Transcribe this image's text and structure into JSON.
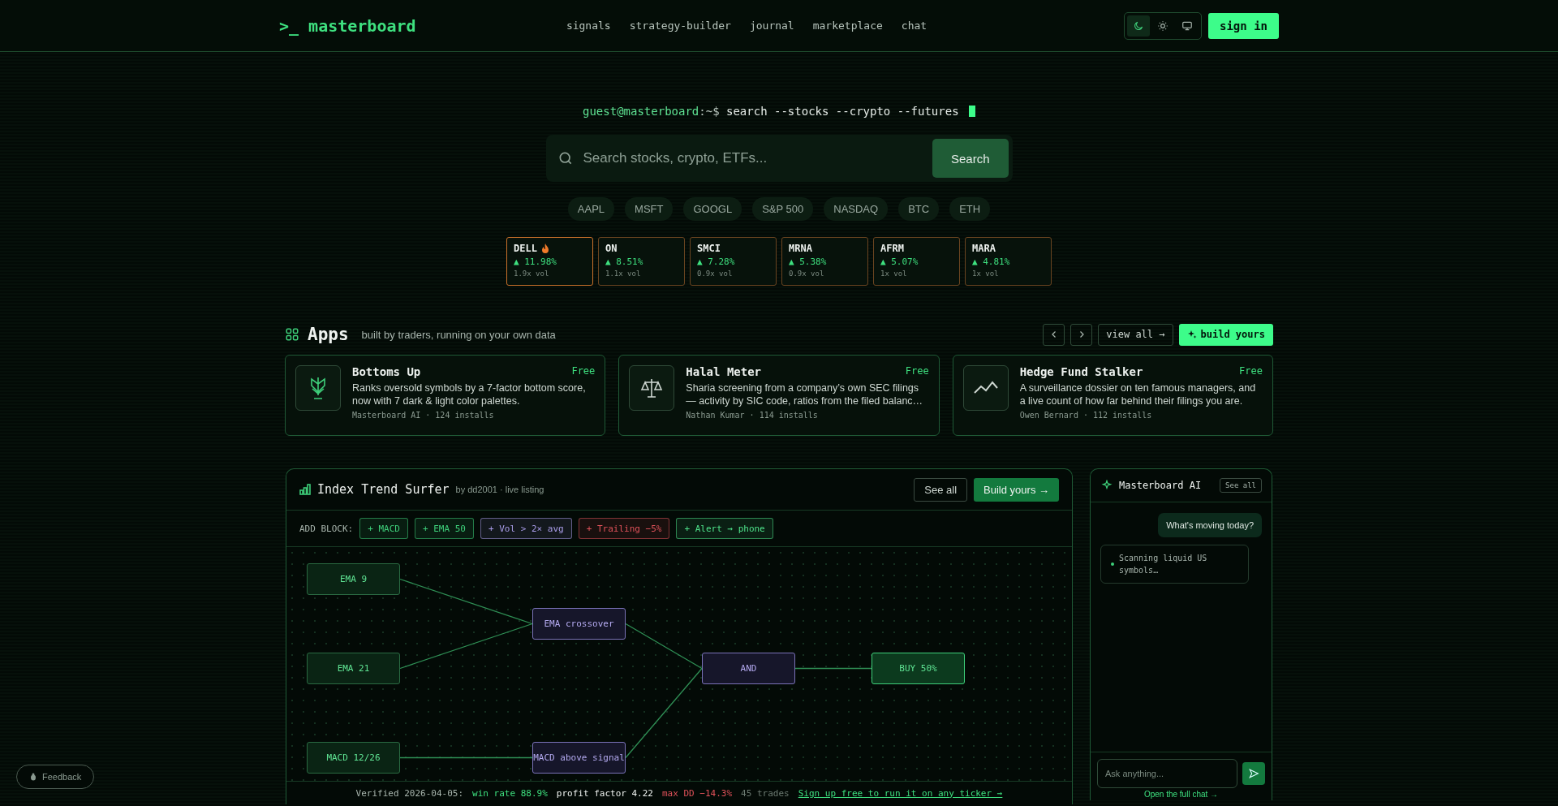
{
  "header": {
    "logo": ">_ masterboard",
    "nav": [
      "signals",
      "strategy-builder",
      "journal",
      "marketplace",
      "chat"
    ],
    "theme_options": [
      {
        "kind": "dark",
        "selected": true
      },
      {
        "kind": "light",
        "selected": false
      },
      {
        "kind": "system",
        "selected": false
      }
    ],
    "sign_in": "sign in"
  },
  "hero": {
    "prompt_user": "guest@masterboard",
    "prompt_path": ":~$",
    "command": "search --stocks --crypto --futures",
    "search": {
      "placeholder": "Search stocks, crypto, ETFs...",
      "button": "Search"
    },
    "chips": [
      "AAPL",
      "MSFT",
      "GOOGL",
      "S&P 500",
      "NASDAQ",
      "BTC",
      "ETH"
    ],
    "movers": [
      {
        "symbol": "DELL",
        "hot": true,
        "change": "▲ 11.98%",
        "volume": "1.9x vol"
      },
      {
        "symbol": "ON",
        "hot": false,
        "change": "▲ 8.51%",
        "volume": "1.1x vol"
      },
      {
        "symbol": "SMCI",
        "hot": false,
        "change": "▲ 7.28%",
        "volume": "0.9x vol"
      },
      {
        "symbol": "MRNA",
        "hot": false,
        "change": "▲ 5.38%",
        "volume": "0.9x vol"
      },
      {
        "symbol": "AFRM",
        "hot": false,
        "change": "▲ 5.07%",
        "volume": "1x vol"
      },
      {
        "symbol": "MARA",
        "hot": false,
        "change": "▲ 4.81%",
        "volume": "1x vol"
      }
    ]
  },
  "apps": {
    "title": "Apps",
    "subtitle": "built by traders, running on your own data",
    "view_all": "view all →",
    "build": "build yours",
    "items": [
      {
        "kind": "plant",
        "name": "Bottoms Up",
        "price": "Free",
        "description": "Ranks oversold symbols by a 7-factor bottom score, now with 7 dark & light color palettes.",
        "meta": "Masterboard AI · 124 installs"
      },
      {
        "kind": "scale",
        "name": "Halal Meter",
        "price": "Free",
        "description": "Sharia screening from a company’s own SEC filings — activity by SIC code, ratios from the filed balanc…",
        "meta": "Nathan Kumar · 114 installs"
      },
      {
        "kind": "chart",
        "name": "Hedge Fund Stalker",
        "price": "Free",
        "description": "A surveillance dossier on ten famous managers, and a live count of how far behind their filings you are.",
        "meta": "Owen Bernard · 112 installs"
      }
    ]
  },
  "builder": {
    "title": "Index Trend Surfer",
    "byline": "by dd2001 · live listing",
    "see_all": "See all",
    "build_yours": "Build yours →",
    "add_block_label": "ADD BLOCK:",
    "blocks": [
      {
        "label": "+ MACD",
        "color": "#3ecf7a"
      },
      {
        "label": "+ EMA 50",
        "color": "#3ecf7a"
      },
      {
        "label": "+ Vol > 2× avg",
        "color": "#a99ce8"
      },
      {
        "label": "+ Trailing −5%",
        "color": "#e0525a"
      },
      {
        "label": "+ Alert → phone",
        "color": "#4ee28a"
      }
    ],
    "nodes": [
      {
        "label": "EMA 9",
        "kind": "indicator"
      },
      {
        "label": "EMA 21",
        "kind": "indicator"
      },
      {
        "label": "MACD 12/26",
        "kind": "indicator"
      },
      {
        "label": "EMA crossover",
        "kind": "condition"
      },
      {
        "label": "MACD above signal",
        "kind": "condition"
      },
      {
        "label": "AND",
        "kind": "condition"
      },
      {
        "label": "BUY 50%",
        "kind": "action"
      }
    ],
    "stats": [
      {
        "text": "Verified 2026-04-05:",
        "kind": "plain"
      },
      {
        "text": "win rate 88.9%",
        "kind": "good"
      },
      {
        "text": "profit factor 4.22",
        "kind": "strong"
      },
      {
        "text": "max DD −14.3%",
        "kind": "bad"
      },
      {
        "text": "45 trades",
        "kind": "muted"
      },
      {
        "text": "Sign up free to run it on any ticker →",
        "kind": "link"
      }
    ]
  },
  "chat": {
    "title": "Masterboard AI",
    "see_all": "See all",
    "messages": [
      {
        "kind": "user",
        "text": "What's moving today?"
      },
      {
        "kind": "assistant",
        "text": "Scanning liquid US symbols…"
      }
    ],
    "placeholder": "Ask anything...",
    "open_link": "Open the full chat →"
  },
  "feedback": "Feedback"
}
